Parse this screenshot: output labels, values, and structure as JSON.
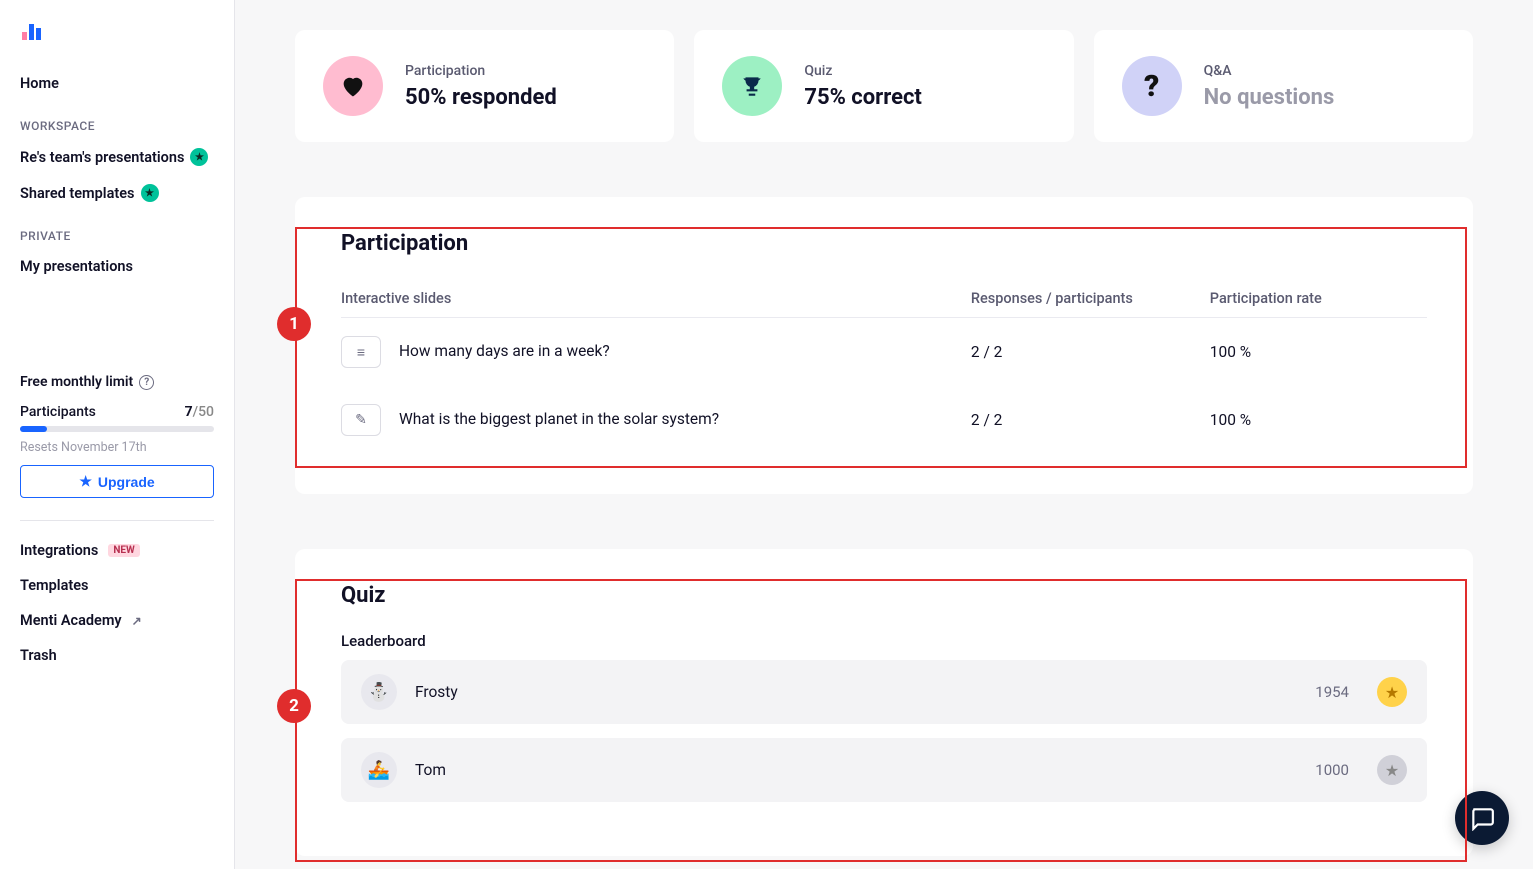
{
  "sidebar": {
    "home": "Home",
    "workspace_label": "WORKSPACE",
    "team_presentations": "Re's team's presentations",
    "shared_templates": "Shared templates",
    "private_label": "PRIVATE",
    "my_presentations": "My presentations",
    "limit_title": "Free monthly limit",
    "participants_label": "Participants",
    "participants_used": "7",
    "participants_max": "/50",
    "participants_pct": 14,
    "reset_text": "Resets November 17th",
    "upgrade": "Upgrade",
    "integrations": "Integrations",
    "integrations_badge": "NEW",
    "templates": "Templates",
    "menti_academy": "Menti Academy",
    "trash": "Trash"
  },
  "stats": {
    "participation": {
      "label": "Participation",
      "value": "50% responded"
    },
    "quiz": {
      "label": "Quiz",
      "value": "75% correct"
    },
    "qa": {
      "label": "Q&A",
      "value": "No questions"
    }
  },
  "participation": {
    "title": "Participation",
    "col1": "Interactive slides",
    "col2": "Responses / participants",
    "col3": "Participation rate",
    "rows": [
      {
        "icon": "text-icon",
        "glyph": "≡",
        "question": "How many days are in a week?",
        "responses": "2 / 2",
        "rate": "100 %"
      },
      {
        "icon": "pencil-icon",
        "glyph": "✎",
        "question": "What is the biggest planet in the solar system?",
        "responses": "2 / 2",
        "rate": "100 %"
      }
    ]
  },
  "quiz": {
    "title": "Quiz",
    "sub": "Leaderboard",
    "rows": [
      {
        "avatar": "⛄",
        "name": "Frosty",
        "score": "1954",
        "medal": "gold"
      },
      {
        "avatar": "🚣",
        "name": "Tom",
        "score": "1000",
        "medal": "grey"
      }
    ]
  },
  "annotations": {
    "a1": "1",
    "a2": "2"
  }
}
